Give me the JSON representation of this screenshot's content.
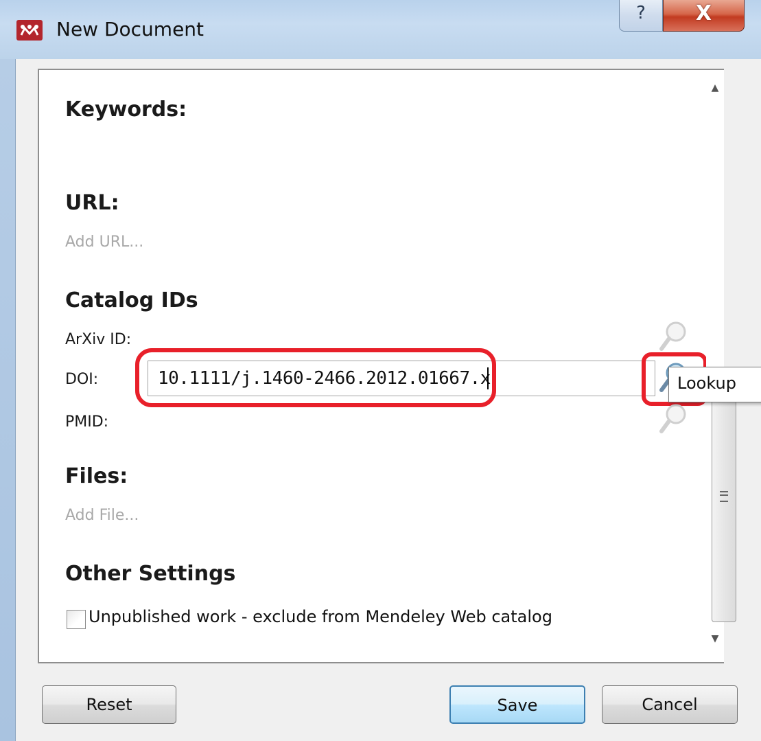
{
  "window": {
    "title": "New Document",
    "help_label": "?",
    "close_label": "X"
  },
  "sections": {
    "keywords_title": "Keywords:",
    "url_title": "URL:",
    "url_placeholder": "Add URL...",
    "catalog_title": "Catalog IDs",
    "files_title": "Files:",
    "files_placeholder": "Add File...",
    "other_title": "Other Settings"
  },
  "catalog": {
    "arxiv_label": "ArXiv ID:",
    "doi_label": "DOI:",
    "doi_value": "10.1111/j.1460-2466.2012.01667.x",
    "pmid_label": "PMID:"
  },
  "tooltip": {
    "text": "Lookup"
  },
  "settings": {
    "unpublished_label": "Unpublished work - exclude from Mendeley Web catalog",
    "unpublished_checked": false
  },
  "buttons": {
    "reset": "Reset",
    "save": "Save",
    "cancel": "Cancel"
  },
  "colors": {
    "highlight": "#e8202a",
    "app_icon": "#b3262d"
  },
  "icons": {
    "app": "mendeley-logo-icon",
    "lookup": "magnifier-icon"
  }
}
